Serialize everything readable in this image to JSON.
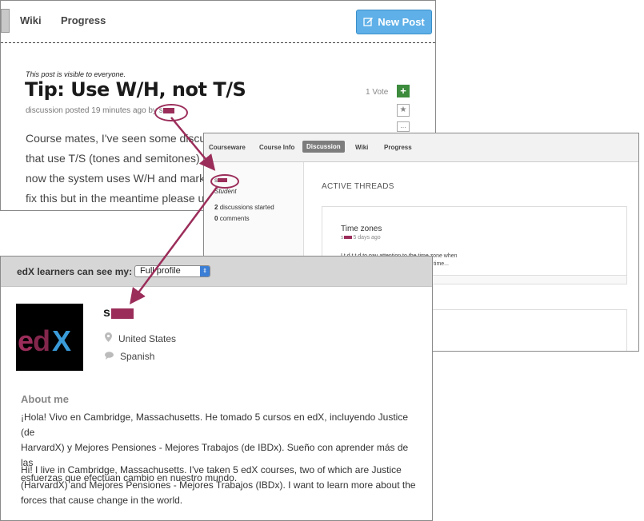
{
  "discussion_post": {
    "nav": {
      "tabs": [
        "Wiki",
        "Progress"
      ],
      "new_post_label": "New Post"
    },
    "visibility_note": "This post is visible to everyone.",
    "title": "Tip: Use W/H, not T/S",
    "meta_prefix": "discussion posted 19 minutes ago by s",
    "votes_label": "1 Vote",
    "body_lines": [
      "Course mates, I've seen some discuss",
      "that use T/S (tones and semitones) in",
      "now the system uses W/H and marks",
      "fix this but in the meantime please us"
    ]
  },
  "user_discussion_profile": {
    "nav": {
      "tabs": [
        "Courseware",
        "Course Info",
        "Discussion",
        "Wiki",
        "Progress"
      ],
      "active_tab": "Discussion"
    },
    "username_initial": "s",
    "role": "Student",
    "discussions_count": "2",
    "discussions_label": "discussions started",
    "comments_count": "0",
    "comments_label": "comments",
    "active_threads_heading": "ACTIVE THREADS",
    "thread": {
      "title": "Time zones",
      "meta_initial": "s",
      "meta_time": "5 days ago",
      "excerpt_line1": "I  t         d  t  t  d  to pay attention to the time zone when",
      "excerpt_line2": "to submit my assignment at noon my time..."
    }
  },
  "learner_profile": {
    "visibility_label": "edX learners can see my:",
    "visibility_select_value": "Full profile",
    "name_initial": "s",
    "logo_text": {
      "e": "e",
      "d": "d",
      "x": "X"
    },
    "country": "United States",
    "language": "Spanish",
    "about_heading": "About me",
    "about_spanish": [
      "¡Hola! Vivo en Cambridge, Massachusetts. He tomado 5 cursos en edX, incluyendo Justice (de",
      "HarvardX) y Mejores Pensiones - Mejores Trabajos (de IBDx). Sueño con aprender más de las",
      "esfuerzas que efectuan cambio en nuestro mundo."
    ],
    "about_english": [
      "Hi! I live in Cambridge, Massachusetts. I've taken 5 edX courses, two of which are Justice",
      "(HarvardX) and Mejores Pensiones - Mejores Trabajos (IBDx). I want to learn more about the",
      "forces that cause change in the world."
    ]
  },
  "colors": {
    "accent": "#9b2d5a",
    "new_post_button": "#5fb0e8",
    "vote_plus": "#3d8b3d",
    "select_arrow": "#3b7ed6"
  },
  "icons": [
    "pencil-square-icon",
    "plus-icon",
    "star-icon",
    "more-icon",
    "map-marker-icon",
    "speech-bubble-icon",
    "edx-logo"
  ]
}
